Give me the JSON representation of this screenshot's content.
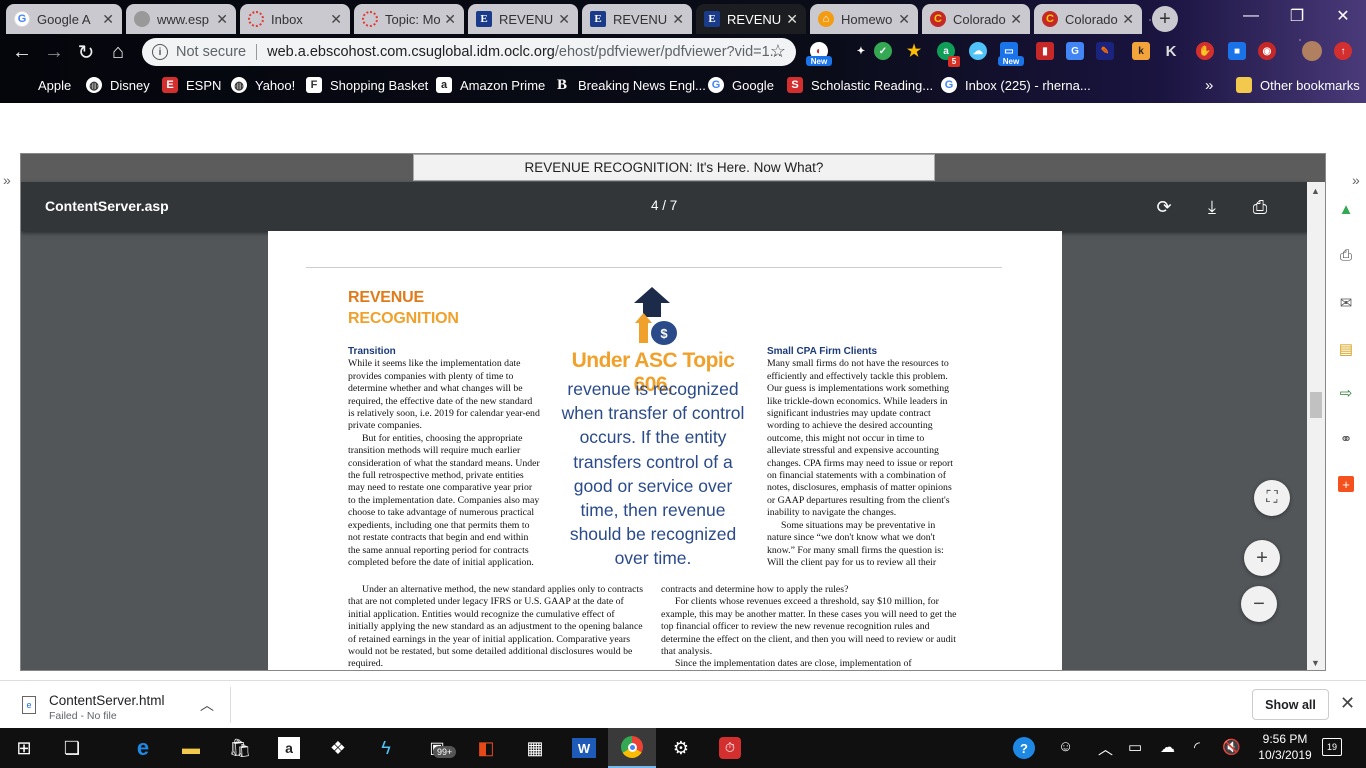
{
  "browser": {
    "tabs": [
      {
        "title": "Google A",
        "icon": "google-g-icon",
        "active": false
      },
      {
        "title": "www.esp",
        "icon": "grey-globe-icon",
        "active": false
      },
      {
        "title": "Inbox",
        "icon": "loading-ring-icon",
        "active": false
      },
      {
        "title": "Topic: Mo",
        "icon": "loading-ring-icon",
        "active": false
      },
      {
        "title": "REVENUE",
        "icon": "ebsco-e-icon",
        "active": false
      },
      {
        "title": "REVENUE",
        "icon": "ebsco-e-icon",
        "active": false
      },
      {
        "title": "REVENU",
        "icon": "ebsco-e-icon",
        "active": true
      },
      {
        "title": "Homewo",
        "icon": "home-icon",
        "active": false
      },
      {
        "title": "Colorado",
        "icon": "colorado-icon",
        "active": false
      },
      {
        "title": "Colorado",
        "icon": "colorado-icon",
        "active": false
      }
    ],
    "url": {
      "security_label": "Not secure",
      "host": "web.a.ebscohost.com.csuglobal.idm.oclc.org",
      "path": "/ehost/pdfviewer/pdfviewer?vid=1..."
    },
    "bookmarks": [
      {
        "label": "Apple",
        "icon": "apple-icon"
      },
      {
        "label": "Disney",
        "icon": "globe-icon"
      },
      {
        "label": "ESPN",
        "icon": "espn-icon"
      },
      {
        "label": "Yahoo!",
        "icon": "globe-icon"
      },
      {
        "label": "Shopping Basket",
        "icon": "basket-icon"
      },
      {
        "label": "Amazon Prime",
        "icon": "amazon-icon"
      },
      {
        "label": "Breaking News Engl...",
        "icon": "b-icon"
      },
      {
        "label": "Google",
        "icon": "google-g-icon"
      },
      {
        "label": "Scholastic Reading...",
        "icon": "scholastic-icon"
      },
      {
        "label": "Inbox (225) - rherna...",
        "icon": "google-g-icon"
      }
    ],
    "bookmarks_overflow": "»",
    "other_bookmarks": "Other bookmarks",
    "extension_badges": {
      "new1": "New",
      "count": "5",
      "new2": "New"
    }
  },
  "viewer": {
    "document_title": "REVENUE RECOGNITION: It's Here. Now What?",
    "file_name": "ContentServer.asp",
    "page_indicator": "4 / 7"
  },
  "article": {
    "header_line1": "REVENUE",
    "header_line2": "RECOGNITION",
    "left_heading": "Transition",
    "left_p1": "While it seems like the implementation date provides companies with plenty of time to determine whether and what changes will be required, the effective date of the new standard is relatively soon, i.e. 2019 for calendar year-end private companies.",
    "left_p2": "But for entities, choosing the appropriate transition methods will require much earlier consideration of what the standard means. Under the full retrospective method, private entities may need to restate one comparative year prior to the implementation date. Companies also may choose to take advantage of numerous practical expedients, including one that permits them to not restate contracts that begin and end within the same annual reporting period for contracts completed before the date of initial application.",
    "pull_head": "Under ASC Topic 606,",
    "pull_body": "revenue is recognized when transfer of control occurs. If the entity transfers control of a good or service over time, then revenue should be recognized over time.",
    "right_heading": "Small CPA Firm Clients",
    "right_p1": "Many small firms do not have the resources to efficiently and effectively tackle this problem. Our guess is implementations work something like trickle-down economics. While leaders in significant industries may update contract wording to achieve the desired accounting outcome, this might not occur in time to alleviate stressful and expensive accounting changes. CPA firms may need to issue or report on financial statements with a combination of notes, disclosures, emphasis of matter opinions or GAAP departures resulting from the client's inability to navigate the changes.",
    "right_p2": "Some situations may be preventative in nature since “we don't know what we don't know.” For many small firms the question is: Will the client pay for us to review all their",
    "bottom_left": "Under an alternative method, the new standard applies only to contracts that are not completed under legacy IFRS or U.S. GAAP at the date of initial application. Entities would recognize the cumulative effect of initially applying the new standard as an adjustment to the opening balance of retained earnings in the year of initial application. Comparative years would not be restated, but some detailed additional disclosures would be required.",
    "bottom_right_p1": "contracts and determine how to apply the rules?",
    "bottom_right_p2": "For clients whose revenues exceed a threshold, say $10 million, for example, this may be another matter. In these cases you will need to get the top financial officer to review the new revenue recognition rules and determine the effect on the client, and then you will need to review or audit that analysis.",
    "bottom_right_p3": "Since the implementation dates are close, implementation of"
  },
  "downloads": {
    "file_name": "ContentServer.html",
    "status": "Failed - No file",
    "show_all": "Show all"
  },
  "taskbar": {
    "store_badge": "99+",
    "time": "9:56 PM",
    "date": "10/3/2019",
    "notification_count": "19"
  }
}
